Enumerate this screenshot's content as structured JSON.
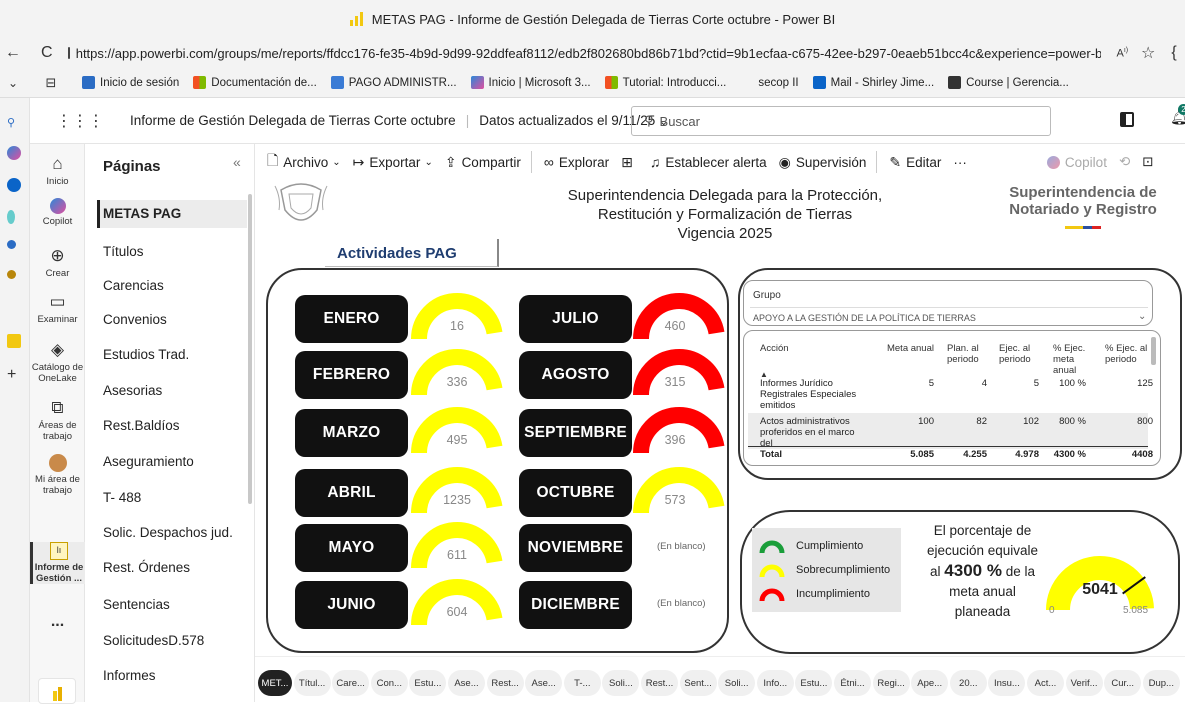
{
  "window": {
    "title": "METAS PAG - Informe de Gestión Delegada de Tierras Corte octubre - Power BI"
  },
  "browser": {
    "url": "https://app.powerbi.com/groups/me/reports/ffdcc176-fe35-4b9d-9d99-92ddfeaf8112/edb2f802680bd86b71bd?ctid=9b1ecfaa-c675-42ee-b297-0eaeb51bcc4c&experience=power-bi",
    "bookmarks": [
      "Inicio de sesión",
      "Documentación de...",
      "PAGO ADMINISTR...",
      "Inicio | Microsoft 3...",
      "Tutorial: Introducci...",
      "secop II",
      "Mail - Shirley Jime...",
      "Course | Gerencia..."
    ],
    "notif_count": "2"
  },
  "pbi": {
    "report_title": "Informe de Gestión Delegada de Tierras Corte octubre",
    "data_updated": "Datos actualizados el 9/11/25",
    "search_placeholder": "Buscar"
  },
  "rail": [
    {
      "label": "Inicio",
      "icon": "home-icon"
    },
    {
      "label": "Copilot",
      "icon": "copilot-icon"
    },
    {
      "label": "Crear",
      "icon": "plus-icon"
    },
    {
      "label": "Examinar",
      "icon": "folder-icon"
    },
    {
      "label": "Catálogo de OneLake",
      "icon": "onelake-icon"
    },
    {
      "label": "Áreas de trabajo",
      "icon": "workspaces-icon"
    },
    {
      "label": "Mi área de trabajo",
      "icon": "avatar-icon"
    },
    {
      "label": "Informe de Gestión ...",
      "icon": "report-icon"
    },
    {
      "label": "...",
      "icon": "more-icon"
    }
  ],
  "pages_pane": {
    "header": "Páginas",
    "items": [
      "METAS PAG",
      "Títulos",
      "Carencias",
      "Convenios",
      "Estudios Trad.",
      "Asesorias",
      "Rest.Baldíos",
      "Aseguramiento",
      "T- 488",
      "Solic. Despachos jud.",
      "Rest. Órdenes",
      "Sentencias",
      "SolicitudesD.578",
      "Informes"
    ]
  },
  "toolbar": {
    "archivo": "Archivo",
    "exportar": "Exportar",
    "compartir": "Compartir",
    "explorar": "Explorar",
    "alerta": "Establecer alerta",
    "supervision": "Supervisión",
    "editar": "Editar",
    "more": "···",
    "copilot": "Copilot"
  },
  "report": {
    "header_line1": "Superintendencia Delegada para la Protección,",
    "header_line2": "Restitución y Formalización  de Tierras",
    "header_line3": "Vigencia 2025",
    "logo_line1": "Superintendencia de",
    "logo_line2": "Notariado y Registro",
    "activities_title": "Actividades PAG",
    "months_left": [
      {
        "name": "ENERO",
        "value": "16",
        "status": "sobrecumplimiento"
      },
      {
        "name": "FEBRERO",
        "value": "336",
        "status": "sobrecumplimiento"
      },
      {
        "name": "MARZO",
        "value": "495",
        "status": "sobrecumplimiento"
      },
      {
        "name": "ABRIL",
        "value": "1235",
        "status": "sobrecumplimiento"
      },
      {
        "name": "MAYO",
        "value": "611",
        "status": "sobrecumplimiento"
      },
      {
        "name": "JUNIO",
        "value": "604",
        "status": "sobrecumplimiento"
      }
    ],
    "months_right": [
      {
        "name": "JULIO",
        "value": "460",
        "status": "incumplimiento"
      },
      {
        "name": "AGOSTO",
        "value": "315",
        "status": "incumplimiento"
      },
      {
        "name": "SEPTIEMBRE",
        "value": "396",
        "status": "incumplimiento"
      },
      {
        "name": "OCTUBRE",
        "value": "573",
        "status": "sobrecumplimiento"
      },
      {
        "name": "NOVIEMBRE",
        "value": "(En blanco)",
        "status": "blank"
      },
      {
        "name": "DICIEMBRE",
        "value": "(En blanco)",
        "status": "blank"
      }
    ],
    "colors": {
      "sobrecumplimiento": "#ffff00",
      "incumplimiento": "#ff0000",
      "cumplimiento": "#1a9e3a"
    },
    "group_filter": {
      "label": "Grupo",
      "value": "APOYO A LA GESTIÓN DE LA POLÍTICA DE TIERRAS"
    },
    "table": {
      "headers": [
        "Acción",
        "Meta anual",
        "Plan. al periodo",
        "Ejec. al periodo",
        "% Ejec. meta anual",
        "% Ejec. al periodo"
      ],
      "rows": [
        [
          "Informes Jurídico Registrales Especiales emitidos",
          "5",
          "4",
          "5",
          "100 %",
          "125"
        ],
        [
          "Actos administrativos proferidos en el marco del",
          "100",
          "82",
          "102",
          "800 %",
          "800"
        ]
      ],
      "total": [
        "Total",
        "5.085",
        "4.255",
        "4.978",
        "4300 %",
        "4408"
      ]
    },
    "legend": [
      "Cumplimiento",
      "Sobrecumplimiento",
      "Incumplimiento"
    ],
    "summary": {
      "line1": "El porcentaje de",
      "line2": "ejecución equivale",
      "pre": "al",
      "pct": "4300 %",
      "post": "de la",
      "line4": "meta anual",
      "line5": "planeada"
    },
    "main_gauge": {
      "value": "5041",
      "min": "0",
      "max": "5.085",
      "fraction": 0.99
    }
  },
  "bottom_tabs": [
    "MET...",
    "Títul...",
    "Care...",
    "Con...",
    "Estu...",
    "Ase...",
    "Rest...",
    "Ase...",
    "T-...",
    "Soli...",
    "Rest...",
    "Sent...",
    "Soli...",
    "Info...",
    "Estu...",
    "Étni...",
    "Regi...",
    "Ape...",
    "20...",
    "Insu...",
    "Act...",
    "Verif...",
    "Cur...",
    "Dup..."
  ]
}
